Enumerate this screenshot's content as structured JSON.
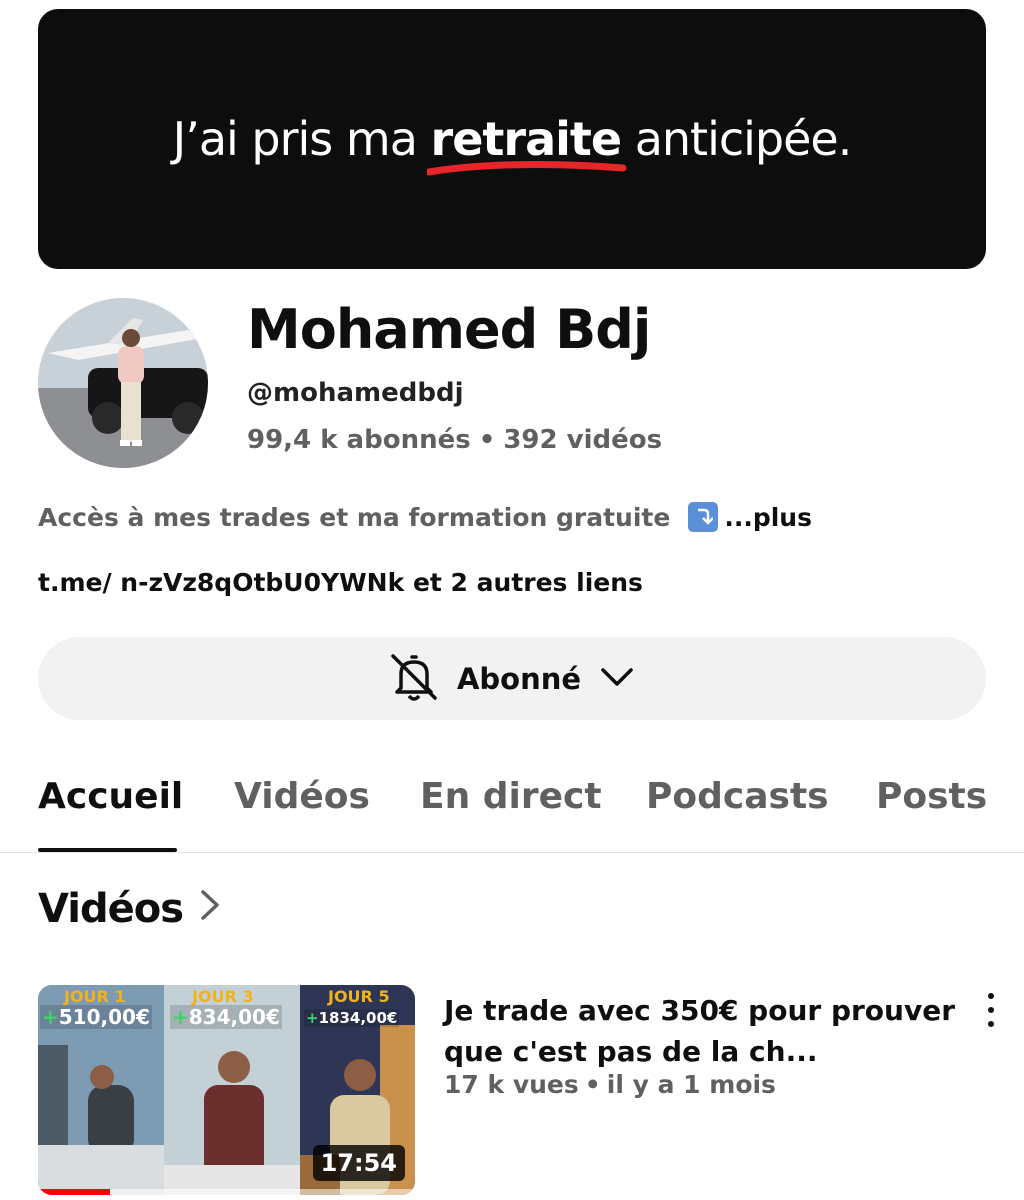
{
  "banner": {
    "text_before": "J’ai pris ma ",
    "text_highlight": "retraite",
    "text_after": " anticipée.",
    "underline_color": "#e8262a"
  },
  "channel": {
    "name": "Mohamed Bdj",
    "handle": "@mohamedbdj",
    "subscribers": "99,4 k abonnés",
    "separator": "•",
    "videos_count": "392 vidéos",
    "description": "Accès à mes trades et ma formation gratuite",
    "description_emoji": "arrow-down-right-icon",
    "more_label": "...plus",
    "link_text": "t.me/ n-zVz8qOtbU0YWNk",
    "link_suffix": " et 2 autres liens"
  },
  "subscribe_button": {
    "label": "Abonné",
    "bell_icon": "bell-off-icon",
    "chevron_icon": "chevron-down-icon"
  },
  "tabs": [
    {
      "label": "Accueil",
      "active": true
    },
    {
      "label": "Vidéos",
      "active": false
    },
    {
      "label": "En direct",
      "active": false
    },
    {
      "label": "Podcasts",
      "active": false
    },
    {
      "label": "Posts",
      "active": false
    }
  ],
  "section": {
    "title": "Vidéos",
    "icon": "chevron-right-icon"
  },
  "video": {
    "thumbnail": {
      "panels": [
        {
          "day": "JOUR 1",
          "gain": "510,00€"
        },
        {
          "day": "JOUR 3",
          "gain": "834,00€"
        },
        {
          "day": "JOUR 5",
          "gain": "1834,00€"
        }
      ],
      "gain_prefix": "+",
      "watched_fraction": 0.19
    },
    "duration": "17:54",
    "title": "Je trade avec 350€ pour prouver que c'est pas de la ch...",
    "views": "17 k vues",
    "separator": "•",
    "age": "il y a 1 mois"
  },
  "colors": {
    "accent_red": "#ff0000",
    "secondary_text": "#606060",
    "button_bg": "#f2f2f2"
  }
}
